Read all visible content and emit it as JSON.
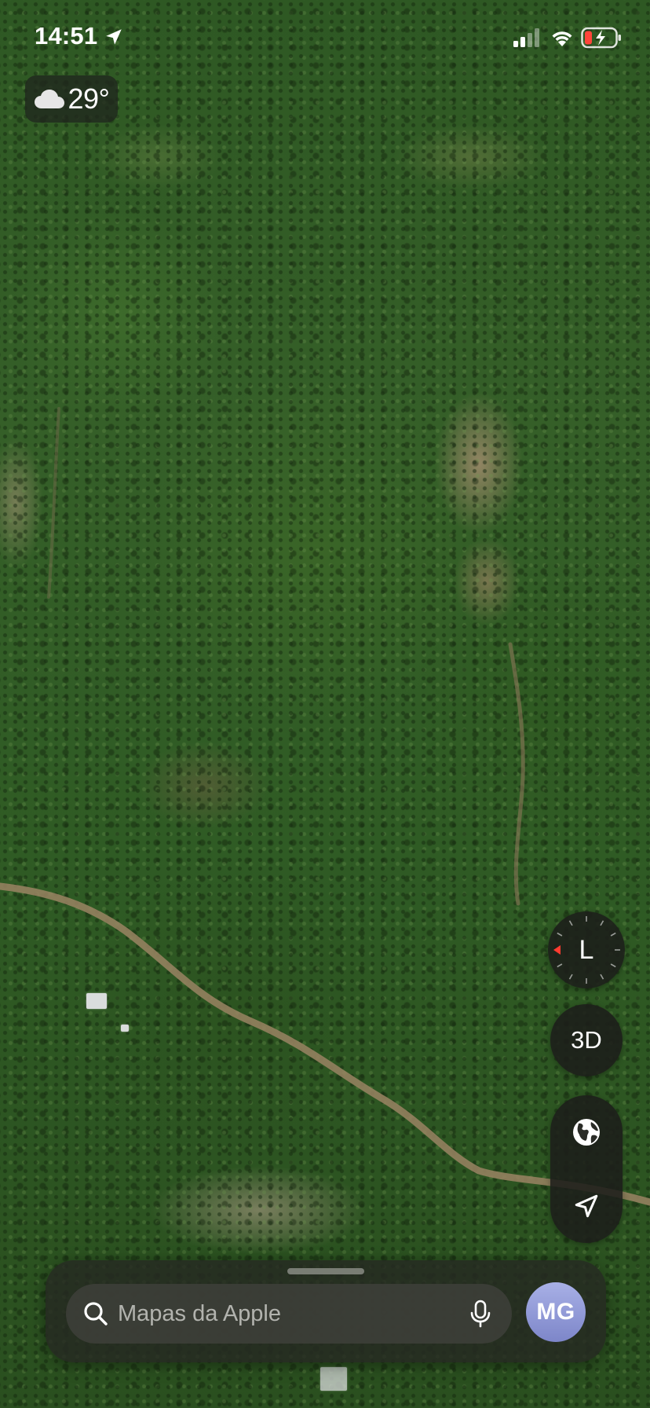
{
  "status_bar": {
    "time": "14:51",
    "location_icon": "location-arrow-icon",
    "signal_icon": "cellular-signal-icon",
    "wifi_icon": "wifi-icon",
    "battery_icon": "battery-charging-icon",
    "battery_color": "#ff453a"
  },
  "weather": {
    "icon": "cloud-icon",
    "temperature": "29°"
  },
  "map": {
    "type": "satellite",
    "compass_letter": "L",
    "compass_needle_color": "#ff3b30",
    "btn_3d_label": "3D",
    "globe_icon": "globe-icon",
    "locate_icon": "location-arrow-icon"
  },
  "search": {
    "placeholder": "Mapas da Apple",
    "search_icon": "search-icon",
    "mic_icon": "microphone-icon"
  },
  "profile": {
    "initials": "MG",
    "avatar_color": "#8e97d6"
  }
}
